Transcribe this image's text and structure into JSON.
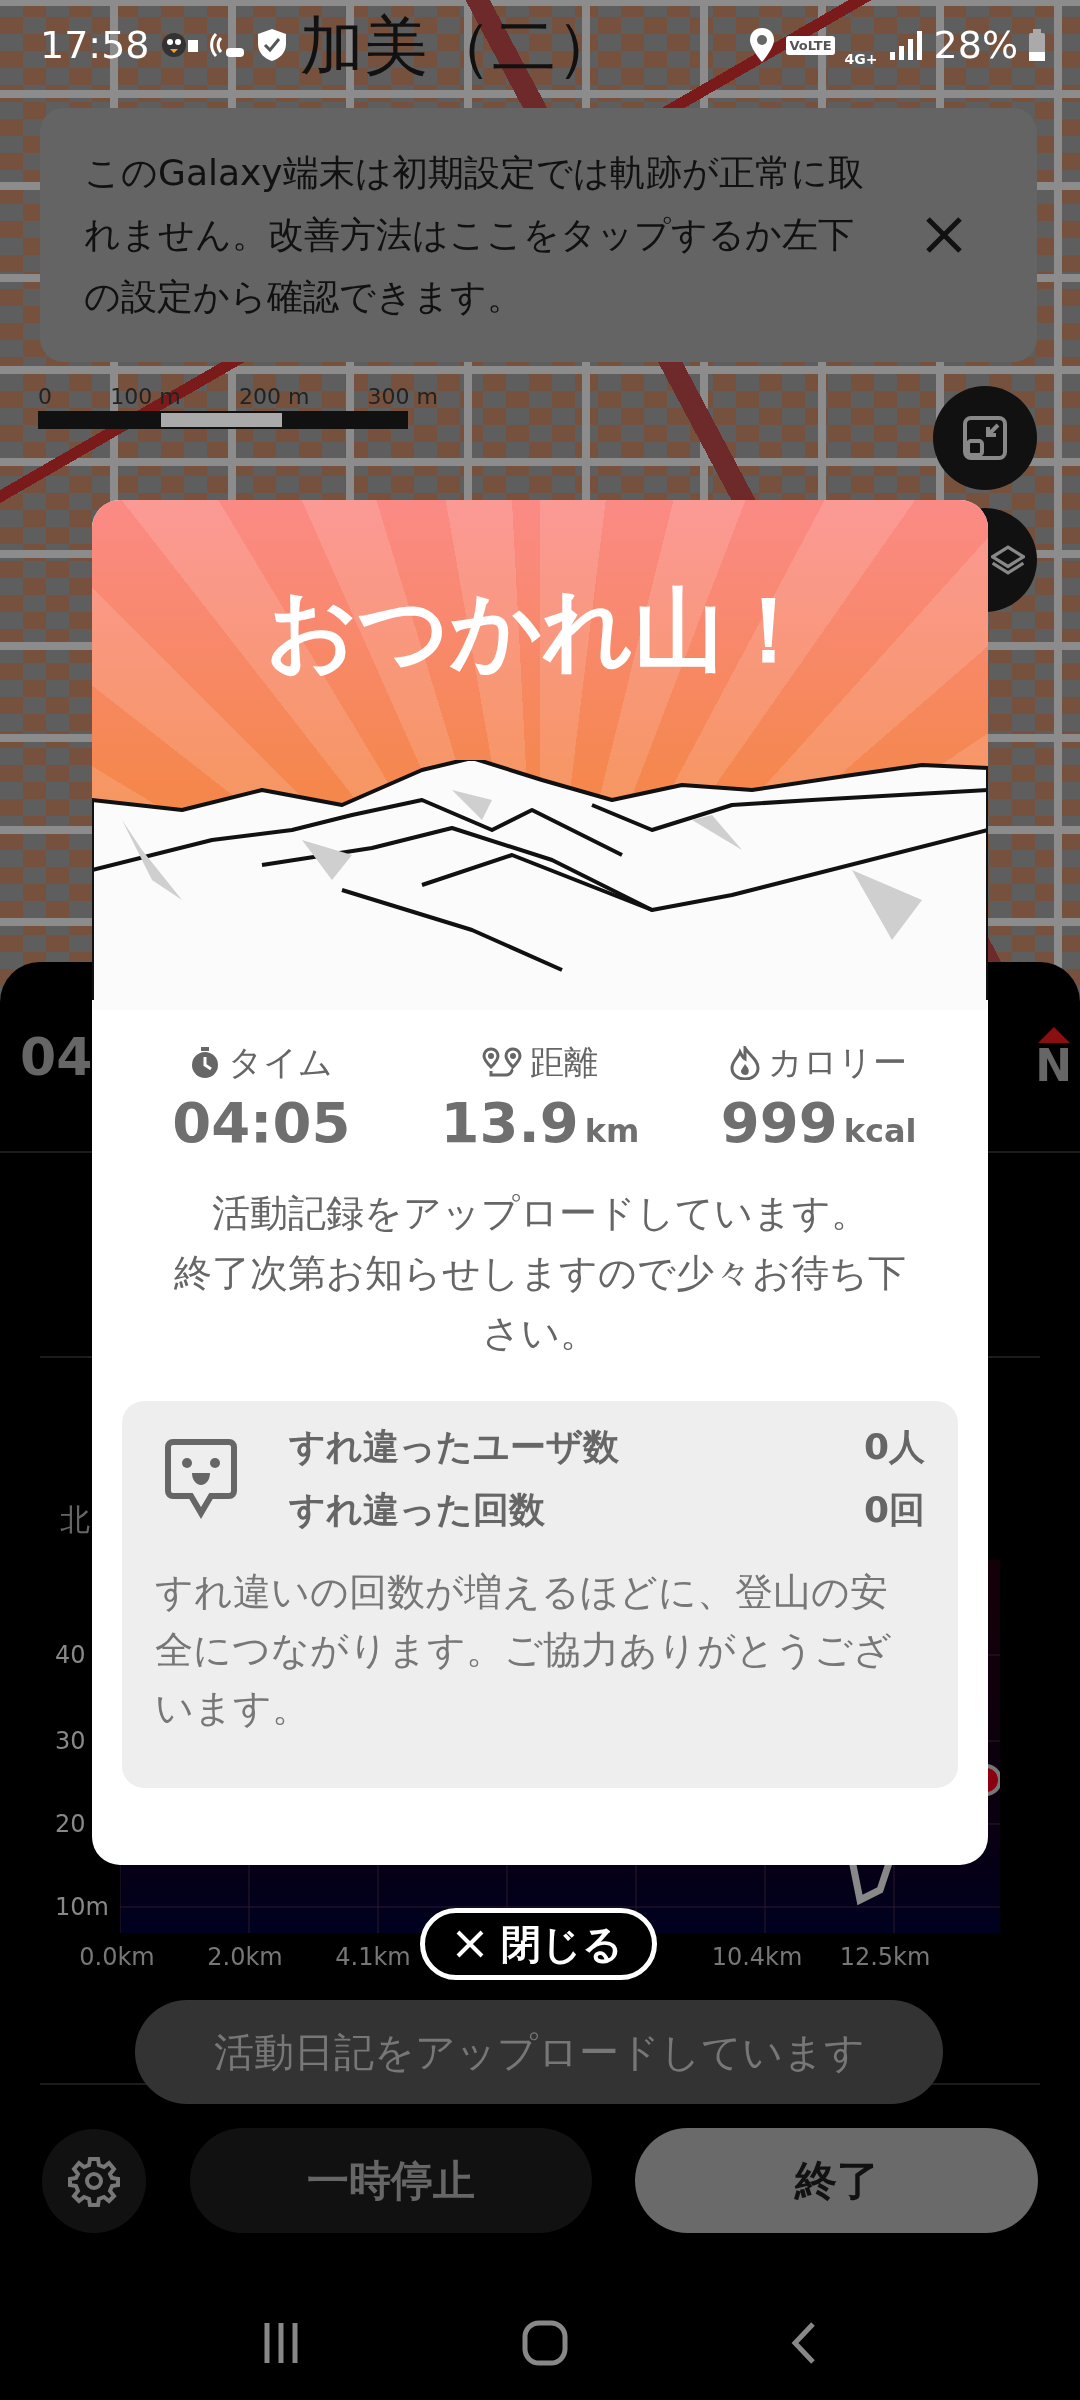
{
  "status_bar": {
    "time": "17:58",
    "network": "VoLTE",
    "signal_type": "4G+",
    "battery": "28%"
  },
  "map": {
    "labels": [
      "加美（二）"
    ],
    "scale_labels": [
      "0",
      "100 m",
      "200 m",
      "300 m"
    ]
  },
  "notice": {
    "text": "このGalaxy端末は初期設定では軌跡が正常に取れません。改善方法はここをタップするか左下の設定から確認できます。"
  },
  "track_panel": {
    "elapsed": "04",
    "compass": "N",
    "direction_label": "北",
    "chart_y_labels": [
      "40",
      "30",
      "20",
      "10m"
    ],
    "chart_x_labels_left": [
      "0.0km",
      "2.0km",
      "4.1km"
    ],
    "chart_x_labels_right": [
      "10.4km",
      "12.5km"
    ]
  },
  "dialog": {
    "title": "おつかれ山！",
    "stats": [
      {
        "kind": "time",
        "label": "タイム",
        "value": "04:05"
      },
      {
        "kind": "distance",
        "label": "距離",
        "value": "13.9",
        "unit": "km"
      },
      {
        "kind": "calories",
        "label": "カロリー",
        "value": "999",
        "unit": "kcal"
      }
    ],
    "message": [
      "活動記録をアップロードしています。",
      "終了次第お知らせしますので少々お待ち下さい。"
    ],
    "passby": {
      "rows": [
        {
          "label": "すれ違ったユーザ数",
          "value": "0人"
        },
        {
          "label": "すれ違った回数",
          "value": "0回"
        }
      ],
      "note": "すれ違いの回数が増えるほどに、登山の安全につながります。ご協力ありがとうございます。"
    },
    "close_button": "閉じる"
  },
  "toast": "活動日記をアップロードしています",
  "controls": {
    "pause": "一時停止",
    "finish": "終了"
  }
}
